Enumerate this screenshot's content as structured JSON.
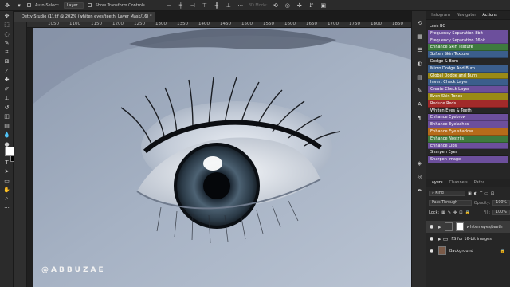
{
  "options_bar": {
    "auto_select_label": "Auto-Select:",
    "auto_select_target": "Layer",
    "show_transform_label": "Show Transform Controls",
    "mode_3d": "3D Mode:"
  },
  "document_tab": {
    "title": "Detty Studio (1).tif @ 202% (whiten eyes/teeth, Layer Mask/16) *"
  },
  "ruler_ticks": [
    "1050",
    "1100",
    "1150",
    "1200",
    "1250",
    "1300",
    "1350",
    "1400",
    "1450",
    "1500",
    "1550",
    "1600",
    "1650",
    "1700",
    "1750",
    "1800",
    "1850",
    "1900"
  ],
  "watermark": "@ABBUZAE",
  "panel_tabs": [
    "Histogram",
    "Navigator",
    "Actions"
  ],
  "actions": {
    "group_label": "Lock BG",
    "items": [
      {
        "label": "Frequency Separation 8bit",
        "color": "#6c4f9c"
      },
      {
        "label": "Frequency Separation 16bit",
        "color": "#6c4f9c"
      },
      {
        "label": "Enhance Skin Texture",
        "color": "#3e7a3e"
      },
      {
        "label": "Soften Skin Texture",
        "color": "#3b5e8c"
      },
      {
        "label": "Dodge & Burn",
        "color": "#262626"
      },
      {
        "label": "Micro Dodge And Burn",
        "color": "#3b5e8c"
      },
      {
        "label": "Global Dodge and Burn",
        "color": "#9a8a16"
      },
      {
        "label": "Invert Check Layer",
        "color": "#3b5e8c"
      },
      {
        "label": "Create Check Layer",
        "color": "#6c4f9c"
      },
      {
        "label": "Even Skin Tones",
        "color": "#9a8a16"
      },
      {
        "label": "Reduce Reds",
        "color": "#a22a2a"
      },
      {
        "label": "Whiten Eyes & Teeth",
        "color": "#262626"
      },
      {
        "label": "Enhance Eyebrow",
        "color": "#6c4f9c"
      },
      {
        "label": "Enhance Eyelashes",
        "color": "#6c4f9c"
      },
      {
        "label": "Enhance Eye shadow",
        "color": "#b66b1a"
      },
      {
        "label": "Enhance Nostrils",
        "color": "#3e7a3e"
      },
      {
        "label": "Enhance Lips",
        "color": "#6c4f9c"
      },
      {
        "label": "Sharpen Eyes",
        "color": "#262626"
      },
      {
        "label": "Sharpen Image",
        "color": "#6c4f9c"
      }
    ]
  },
  "layers_panel": {
    "tabs": [
      "Layers",
      "Channels",
      "Paths"
    ],
    "filter_kind": "Kind",
    "blend_mode": "Pass Through",
    "opacity_label": "Opacity:",
    "opacity_value": "100%",
    "lock_label": "Lock:",
    "fill_label": "Fill:",
    "fill_value": "100%",
    "layers": [
      {
        "name": "whiten eyes/teeth"
      },
      {
        "name": "FS for 16-bit images"
      },
      {
        "name": "Background"
      }
    ]
  }
}
